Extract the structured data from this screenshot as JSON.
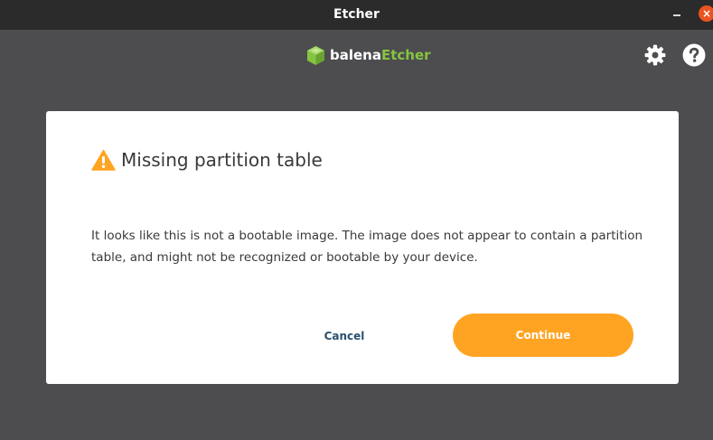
{
  "window": {
    "title": "Etcher",
    "minimize_label": "",
    "close_label": "×"
  },
  "header": {
    "logo_text_a": "balena",
    "logo_text_b": "Etcher",
    "logo_icon": "cube-logo-icon",
    "settings_icon": "gear-icon",
    "help_icon": "help-icon"
  },
  "modal": {
    "title": "Missing partition table",
    "warning_icon": "warning-icon",
    "body": "It looks like this is not a bootable image. The image does not appear to contain a partition table, and might not be recognized or bootable by your device.",
    "cancel_label": "Cancel",
    "continue_label": "Continue"
  },
  "colors": {
    "background": "#4d4d4f",
    "titlebar": "#2b2b2b",
    "accent_orange": "#ffa422",
    "brand_green": "#85c441",
    "close_button": "#e95420",
    "cancel_text": "#2a506f"
  }
}
